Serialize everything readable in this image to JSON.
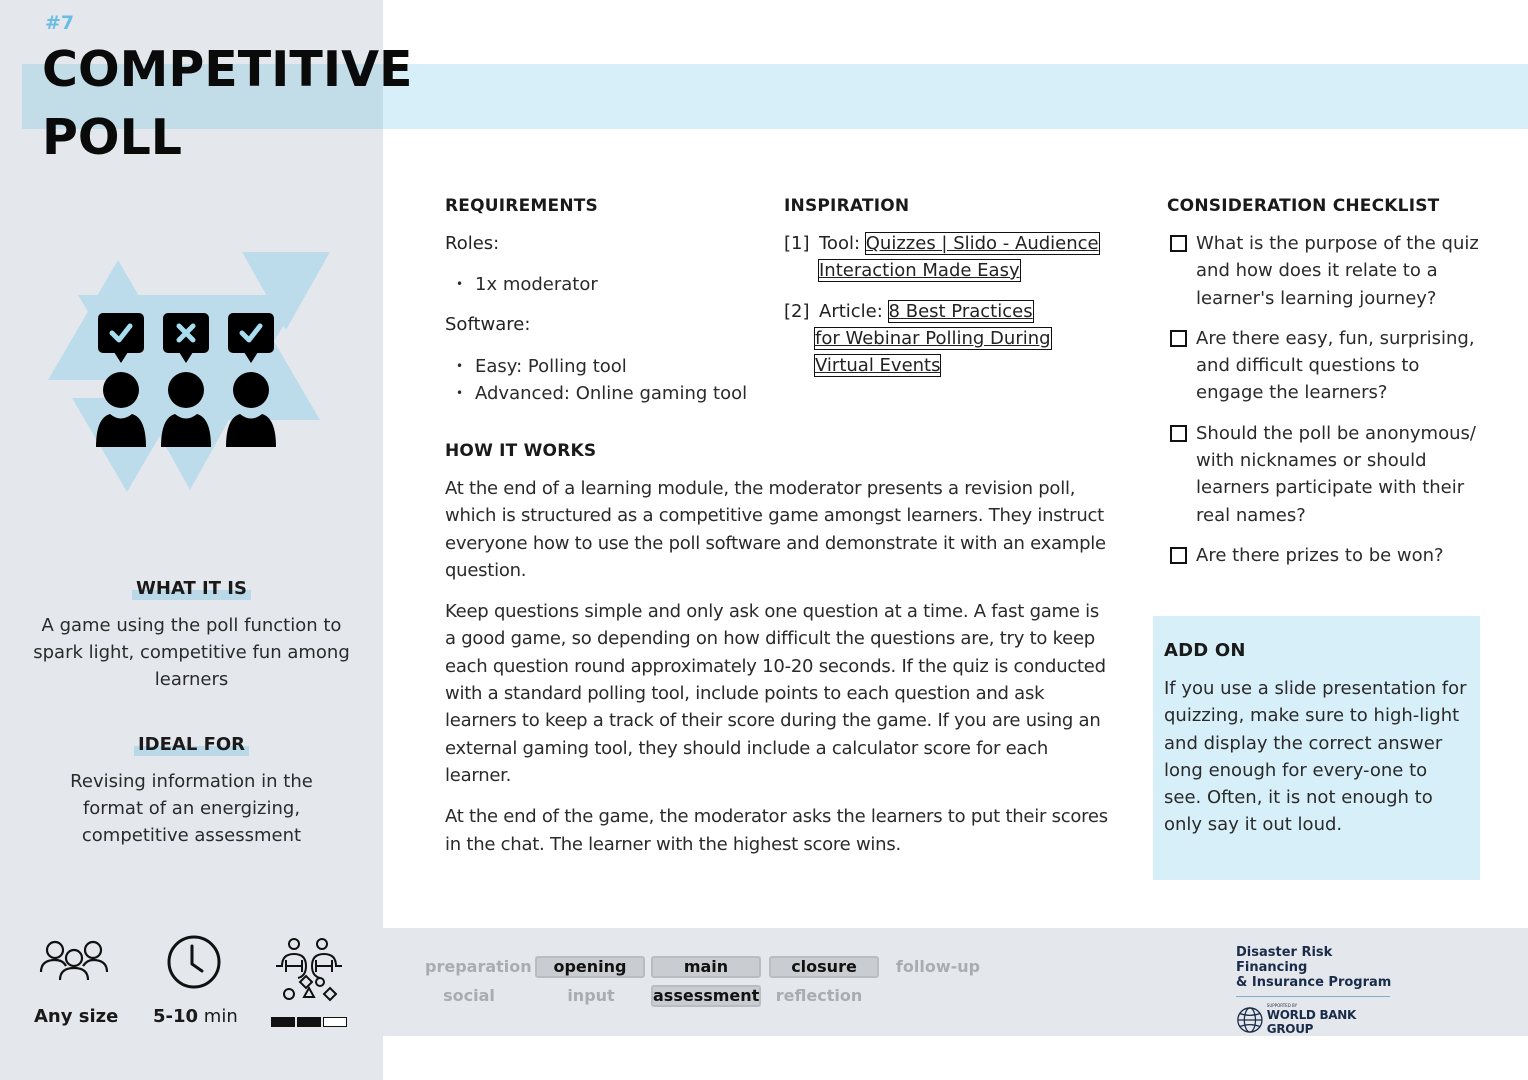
{
  "card": {
    "number": "#7",
    "title_line1": "COMPETITIVE",
    "title_line2": "POLL"
  },
  "sidebar": {
    "hero_icon": "people-with-answer-bubbles-icon",
    "what_it_is": {
      "heading": "WHAT IT IS",
      "text": "A game using the poll function to spark light, competitive fun among learners"
    },
    "ideal_for": {
      "heading": "IDEAL FOR",
      "text": "Revising information in the format of an energizing, competitive assessment"
    },
    "stats": {
      "group_size": {
        "icon": "group-icon",
        "label": "Any size"
      },
      "duration": {
        "icon": "clock-icon",
        "value": "5-10",
        "unit": "min"
      },
      "complexity": {
        "icon": "collaboration-icon",
        "level": 2,
        "max": 3
      }
    }
  },
  "requirements": {
    "heading": "REQUIREMENTS",
    "roles_label": "Roles:",
    "roles": [
      "1x moderator"
    ],
    "software_label": "Software:",
    "software": [
      "Easy: Polling tool",
      "Advanced: Online gaming tool"
    ]
  },
  "inspiration": {
    "heading": "INSPIRATION",
    "items": [
      {
        "num": "[1]",
        "type": "Tool:",
        "link_lines": [
          "Quizzes | Slido - Audience",
          "Interaction Made Easy"
        ]
      },
      {
        "num": "[2]",
        "type": "Article:",
        "link_lines": [
          "8 Best Practices",
          "for Webinar Polling During",
          "Virtual Events"
        ]
      }
    ]
  },
  "how_it_works": {
    "heading": "HOW IT WORKS",
    "paragraphs": [
      "At the end of a learning module, the moderator presents a revision poll, which is structured as a competitive game amongst learners. They instruct everyone how to use the poll software and demonstrate it with an example question.",
      "Keep questions simple and only ask one question at a time. A fast game is a good game, so depending on how difficult the questions are, try to keep each question round approximately 10-20 seconds. If the quiz is conducted with a standard polling tool, include points to each question and ask learners to keep a track of their score during the game. If you are using an external gaming tool, they should include a calculator score for each learner.",
      "At the end of the game, the moderator asks the learners to put their scores in the chat. The learner with the highest score wins."
    ]
  },
  "checklist": {
    "heading": "CONSIDERATION CHECKLIST",
    "items": [
      "What is the purpose of the quiz and how does it relate to a learner's learning journey?",
      "Are there easy, fun, surprising, and difficult questions to engage the learners?",
      "Should the poll be anonymous/ with nicknames or should learners participate with their real names?",
      "Are there prizes to be won?"
    ]
  },
  "add_on": {
    "heading": "ADD ON",
    "text": "If you use a slide presentation for quizzing, make sure to high-light and display the correct answer long enough for every-one to see. Often, it is not enough to only say it out loud."
  },
  "phase_tags": {
    "row1": [
      {
        "label": "preparation",
        "active": false
      },
      {
        "label": "opening",
        "active": true
      },
      {
        "label": "main",
        "active": true
      },
      {
        "label": "closure",
        "active": true
      },
      {
        "label": "follow-up",
        "active": false
      }
    ],
    "row2": [
      {
        "label": "social",
        "active": false
      },
      {
        "label": "input",
        "active": false
      },
      {
        "label": "assessment",
        "active": true
      },
      {
        "label": "reflection",
        "active": false
      }
    ]
  },
  "logo": {
    "program_line1": "Disaster Risk Financing",
    "program_line2": "& Insurance Program",
    "supported_by": "SUPPORTED BY",
    "org": "WORLD BANK GROUP"
  },
  "colors": {
    "sidebar_bg": "#e4e8ed",
    "accent_light_blue": "#d6eff8",
    "number_blue": "#6bbde3",
    "heading_highlight": "#b9d9e8"
  }
}
